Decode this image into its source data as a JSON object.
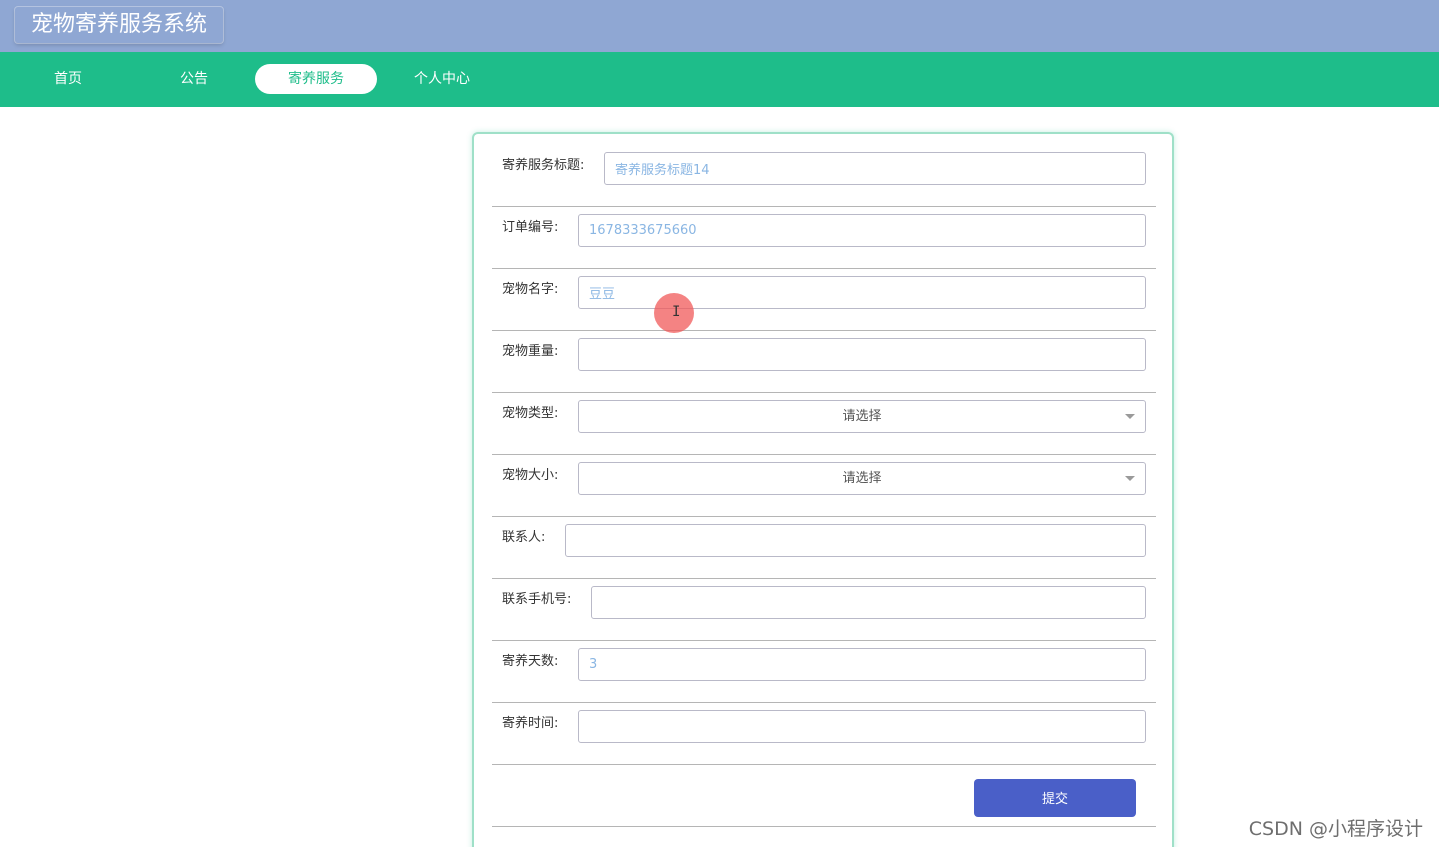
{
  "app": {
    "title": "宠物寄养服务系统"
  },
  "nav": {
    "items": [
      {
        "label": "首页",
        "active": false
      },
      {
        "label": "公告",
        "active": false
      },
      {
        "label": "寄养服务",
        "active": true
      },
      {
        "label": "个人中心",
        "active": false
      }
    ]
  },
  "form": {
    "fields": [
      {
        "label": "寄养服务标题:",
        "value": "寄养服务标题14",
        "type": "text"
      },
      {
        "label": "订单编号:",
        "value": "1678333675660",
        "type": "text"
      },
      {
        "label": "宠物名字:",
        "value": "豆豆",
        "type": "text"
      },
      {
        "label": "宠物重量:",
        "value": "",
        "type": "text"
      },
      {
        "label": "宠物类型:",
        "value": "请选择",
        "type": "select"
      },
      {
        "label": "宠物大小:",
        "value": "请选择",
        "type": "select"
      },
      {
        "label": "联系人:",
        "value": "",
        "type": "text"
      },
      {
        "label": "联系手机号:",
        "value": "",
        "type": "text"
      },
      {
        "label": "寄养天数:",
        "value": "3",
        "type": "text"
      },
      {
        "label": "寄养时间:",
        "value": "",
        "type": "text"
      }
    ],
    "submit_label": "提交"
  },
  "cursor": {
    "glyph": "I"
  },
  "watermark": "CSDN @小程序设计",
  "colors": {
    "title_bar": "#8fa7d3",
    "nav_bar": "#1ebd8a",
    "submit": "#4a5fc8",
    "input_text": "#8ab6e3"
  }
}
